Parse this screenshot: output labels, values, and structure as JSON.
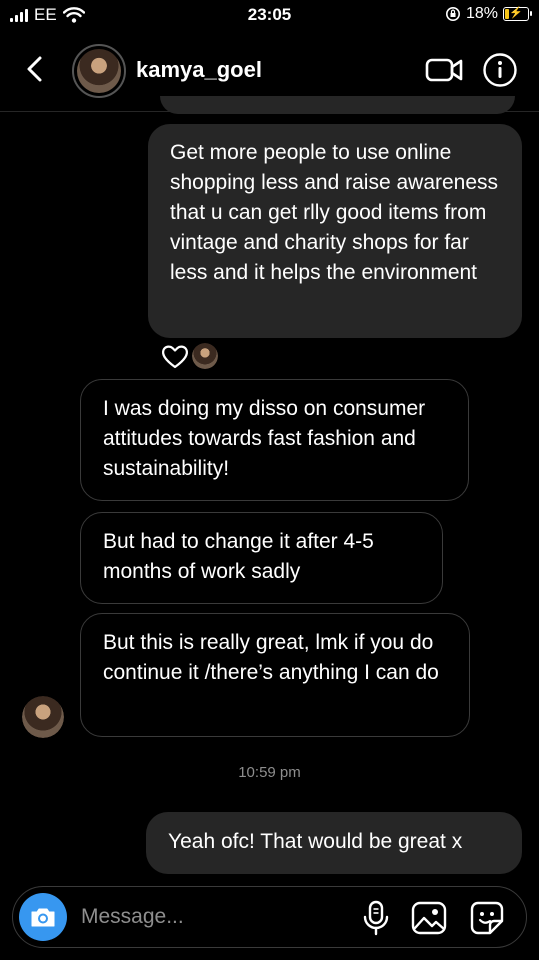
{
  "status_bar": {
    "carrier": "EE",
    "time": "23:05",
    "battery_text": "18%",
    "battery_level": 0.18,
    "icons": [
      "signal-icon",
      "wifi-icon",
      "orientation-lock-icon",
      "battery-charging-icon"
    ]
  },
  "header": {
    "username": "kamya_goel",
    "icons": [
      "back-arrow-icon",
      "avatar",
      "video-call-icon",
      "info-icon"
    ]
  },
  "messages": [
    {
      "direction": "sent",
      "text": "Get more people to use online shopping less and raise awareness that u can get rlly good items from vintage and charity shops for far less and it helps the environment"
    },
    {
      "direction": "received",
      "text": "I was doing my disso on consumer attitudes towards fast fashion and sustainability!"
    },
    {
      "direction": "received",
      "text": "But had to change it after 4-5 months of work sadly"
    },
    {
      "direction": "received",
      "text": "But this is really great, lmk if you do continue it /there’s anything I can do"
    },
    {
      "direction": "sent",
      "text": "Yeah ofc! That would be great x"
    }
  ],
  "reaction": {
    "icon": "heart-icon"
  },
  "timestamp": "10:59 pm",
  "composer": {
    "placeholder": "Message...",
    "icons": [
      "camera-icon",
      "microphone-icon",
      "gallery-icon",
      "sticker-icon"
    ]
  },
  "colors": {
    "background": "#000000",
    "sent_bubble": "#262626",
    "received_border": "#3a3a3a",
    "camera_button": "#3797f0",
    "battery_charging": "#f5c518",
    "muted_text": "#8e8e8e"
  }
}
